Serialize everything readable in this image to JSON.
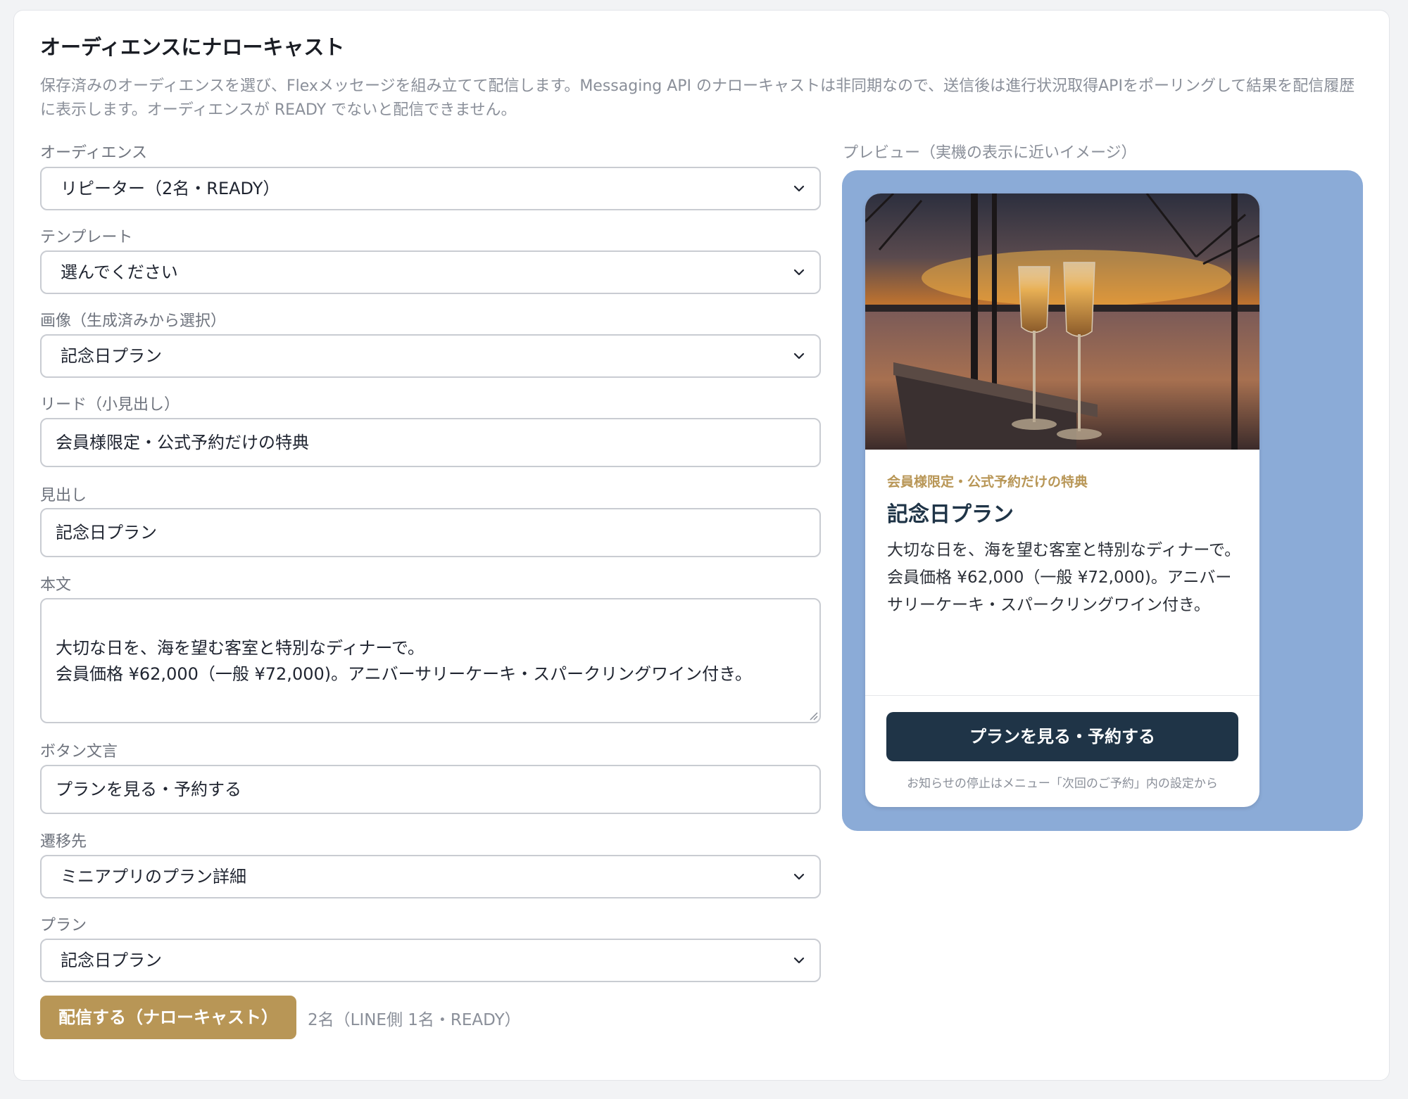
{
  "page": {
    "title": "オーディエンスにナローキャスト",
    "description": "保存済みのオーディエンスを選び、Flexメッセージを組み立てて配信します。Messaging API のナローキャストは非同期なので、送信後は進行状況取得APIをポーリングして結果を配信履歴に表示します。オーディエンスが READY でないと配信できません。"
  },
  "form": {
    "audience": {
      "label": "オーディエンス",
      "value": "リピーター（2名・READY）"
    },
    "template": {
      "label": "テンプレート",
      "value": "選んでください"
    },
    "image": {
      "label": "画像（生成済みから選択）",
      "value": "記念日プラン"
    },
    "lead": {
      "label": "リード（小見出し）",
      "value": "会員様限定・公式予約だけの特典"
    },
    "heading": {
      "label": "見出し",
      "value": "記念日プラン"
    },
    "body": {
      "label": "本文",
      "value": "大切な日を、海を望む客室と特別なディナーで。\n会員価格 ¥62,000（一般 ¥72,000)。アニバーサリーケーキ・スパークリングワイン付き。"
    },
    "button_text": {
      "label": "ボタン文言",
      "value": "プランを見る・予約する"
    },
    "destination": {
      "label": "遷移先",
      "value": "ミニアプリのプラン詳細"
    },
    "plan": {
      "label": "プラン",
      "value": "記念日プラン"
    }
  },
  "actions": {
    "send_label": "配信する（ナローキャスト）",
    "send_meta": "2名（LINE側 1名・READY）"
  },
  "preview": {
    "label": "プレビュー（実機の表示に近いイメージ）",
    "lead": "会員様限定・公式予約だけの特典",
    "heading": "記念日プラン",
    "body": "大切な日を、海を望む客室と特別なディナーで。\n会員価格 ¥62,000（一般 ¥72,000)。アニバーサリーケーキ・スパークリングワイン付き。",
    "button_label": "プランを見る・予約する",
    "footer": "お知らせの停止はメニュー「次回のご予約」内の設定から"
  },
  "colors": {
    "accent_gold": "#b89656",
    "navy": "#1f3447",
    "preview_bg": "#8babd7"
  }
}
